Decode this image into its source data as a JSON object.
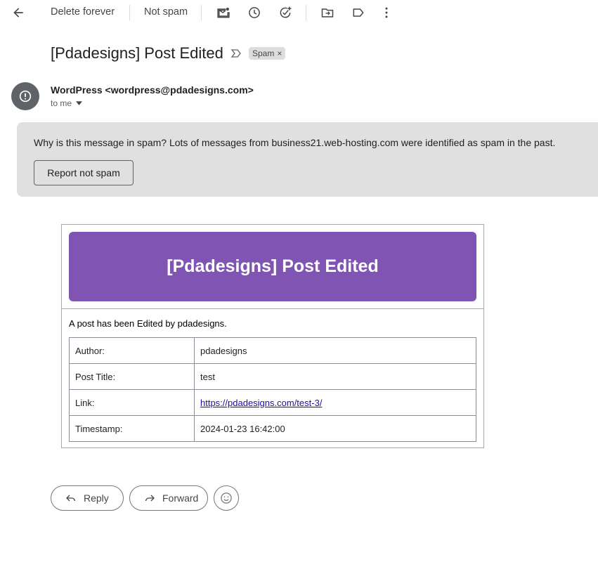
{
  "toolbar": {
    "delete_forever": "Delete forever",
    "not_spam": "Not spam"
  },
  "subject": "[Pdadesigns] Post Edited",
  "label_chip": "Spam",
  "sender": {
    "display": "WordPress <wordpress@pdadesigns.com>",
    "to_me": "to me"
  },
  "banner": {
    "question": "Why is this message in spam?",
    "reason": " Lots of messages from business21.web-hosting.com were identified as spam in the past.",
    "button": "Report not spam"
  },
  "email": {
    "hero_title": "[Pdadesigns] Post Edited",
    "intro": "A post has been Edited by pdadesigns.",
    "rows": [
      {
        "key": "Author:",
        "value": "pdadesigns"
      },
      {
        "key": "Post Title:",
        "value": "test"
      },
      {
        "key": "Link:",
        "value": "https://pdadesigns.com/test-3/"
      },
      {
        "key": "Timestamp:",
        "value": "2024-01-23 16:42:00"
      }
    ]
  },
  "actions": {
    "reply": "Reply",
    "forward": "Forward"
  },
  "colors": {
    "hero_bg": "#7f54b3",
    "banner_bg": "#e0e0e0",
    "avatar_bg": "#5f6368",
    "link": "#1a0dab"
  }
}
